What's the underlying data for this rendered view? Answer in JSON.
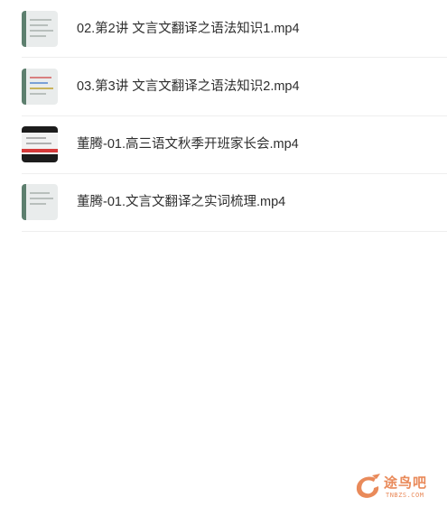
{
  "files": [
    {
      "name": "02.第2讲 文言文翻译之语法知识1.mp4",
      "thumbnail_icon": "video-thumbnail-icon"
    },
    {
      "name": "03.第3讲 文言文翻译之语法知识2.mp4",
      "thumbnail_icon": "video-thumbnail-icon"
    },
    {
      "name": "董腾-01.高三语文秋季开班家长会.mp4",
      "thumbnail_icon": "video-thumbnail-icon"
    },
    {
      "name": "董腾-01.文言文翻译之实词梳理.mp4",
      "thumbnail_icon": "video-thumbnail-icon"
    }
  ],
  "watermark": {
    "text": "途鸟吧",
    "subtext": "TNBZS.COM",
    "color": "#e98a5a"
  }
}
